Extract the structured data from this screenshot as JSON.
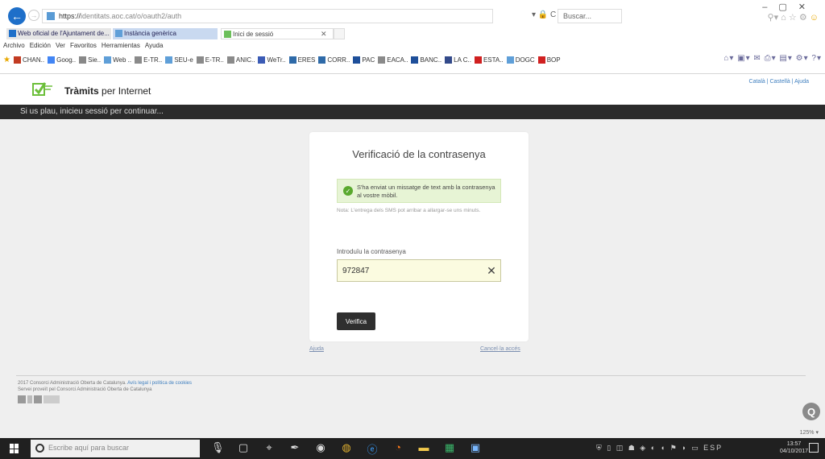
{
  "browser": {
    "url_scheme": "https://",
    "url_rest": "identitats.aoc.cat/o/oauth2/auth",
    "address_controls": "▾ 🔒 C",
    "search_placeholder": "Buscar...",
    "tabs": [
      {
        "label": "Web oficial de l'Ajuntament de..."
      },
      {
        "label": "Instància genèrica"
      },
      {
        "label": "Inici de sessió"
      }
    ],
    "menu": [
      "Archivo",
      "Edición",
      "Ver",
      "Favoritos",
      "Herramientas",
      "Ayuda"
    ],
    "favorites": [
      {
        "label": "CHAN..",
        "color": "#c23b22"
      },
      {
        "label": "Goog..",
        "color": "#4285f4"
      },
      {
        "label": "Sie..",
        "color": "#888888"
      },
      {
        "label": "Web ..",
        "color": "#5f9fd8"
      },
      {
        "label": "E-TR..",
        "color": "#8a8a8a"
      },
      {
        "label": "SEU-e",
        "color": "#5f9fd8"
      },
      {
        "label": "E-TR..",
        "color": "#8a8a8a"
      },
      {
        "label": "ANIC..",
        "color": "#8a8a8a"
      },
      {
        "label": "WeTr..",
        "color": "#3b5bb5"
      },
      {
        "label": "ERES",
        "color": "#2e6aa8"
      },
      {
        "label": "CORR..",
        "color": "#2e6aa8"
      },
      {
        "label": "PAC",
        "color": "#1e4f9a"
      },
      {
        "label": "EACA..",
        "color": "#8a8a8a"
      },
      {
        "label": "BANC..",
        "color": "#1e4f9a"
      },
      {
        "label": "LA C..",
        "color": "#334a8a"
      },
      {
        "label": "ESTA..",
        "color": "#d02020"
      },
      {
        "label": "DOGC",
        "color": "#5f9fd8"
      },
      {
        "label": "BOP",
        "color": "#d02020"
      }
    ]
  },
  "site": {
    "logo_bold": "Tràmits",
    "logo_rest": " per Internet",
    "lang_links": "Català | Castellà | Ajuda",
    "notice": "Si us plau, inicieu sessió per continuar..."
  },
  "card": {
    "title": "Verificació de la contrasenya",
    "alert": "S'ha enviat un missatge de text amb la contrasenya al vostre mòbil.",
    "note": "Nota: L'entrega dels SMS pot arribar a allargar-se uns minuts.",
    "field_label": "Introduïu la contrasenya",
    "field_value": "972847",
    "verify_label": "Verifica",
    "help_link": "Ajuda",
    "cancel_link": "Cancel·la accés"
  },
  "footer": {
    "line1": "2017 Consorci Administració Oberta de Catalunya. ",
    "line1_link": "Avís legal i política de cookies",
    "line2": "Servei proveït pel Consorci Administració Oberta de Catalunya"
  },
  "status": {
    "zoom": "125%"
  },
  "taskbar": {
    "search_placeholder": "Escribe aquí para buscar",
    "lang": "ESP",
    "time": "13:57",
    "date": "04/10/2017"
  },
  "colors": {
    "accent_green": "#5aa92e",
    "dark_bar": "#2b2b2b",
    "link_blue": "#3f7fbf"
  }
}
